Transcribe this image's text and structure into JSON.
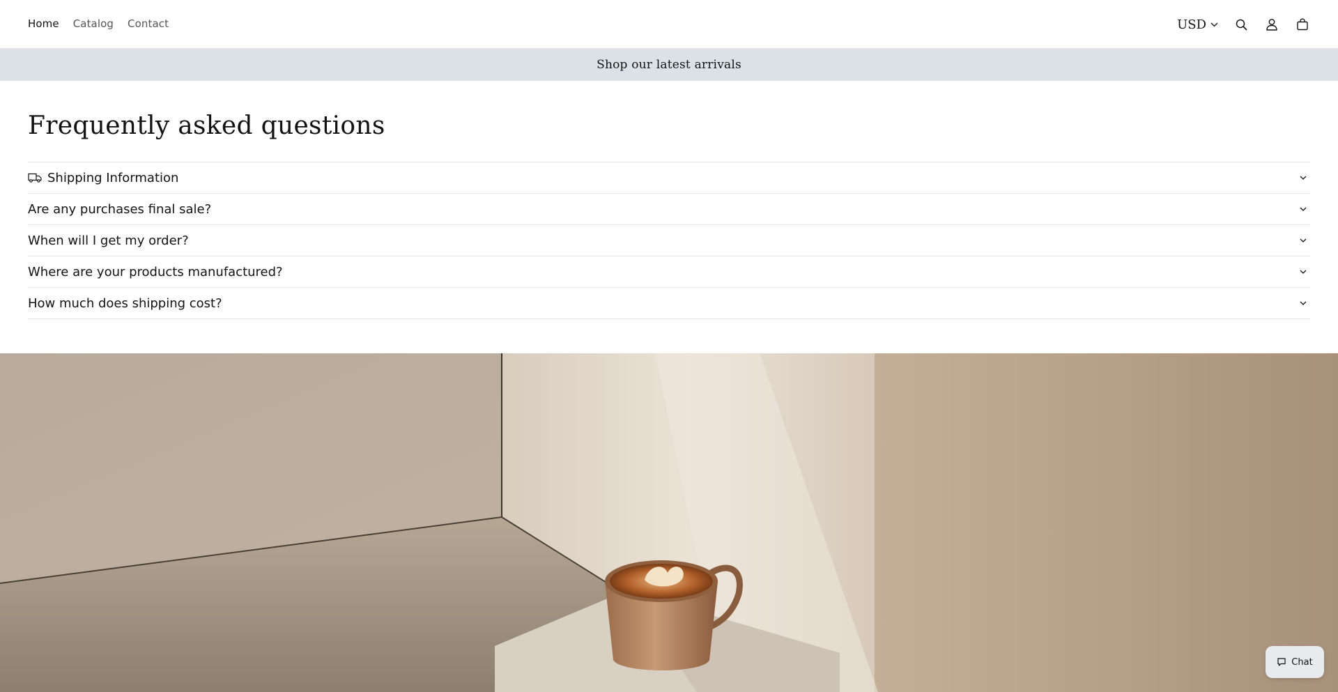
{
  "nav": {
    "items": [
      {
        "label": "Home",
        "active": true
      },
      {
        "label": "Catalog",
        "active": false
      },
      {
        "label": "Contact",
        "active": false
      }
    ]
  },
  "header": {
    "currency": "USD",
    "icons": [
      "search-icon",
      "account-icon",
      "cart-icon"
    ]
  },
  "announcement": {
    "text": "Shop our latest arrivals",
    "background": "#dae2e7"
  },
  "faq": {
    "title": "Frequently asked questions",
    "items": [
      {
        "label": "Shipping Information",
        "icon": "truck-icon"
      },
      {
        "label": "Are any purchases final sale?"
      },
      {
        "label": "When will I get my order?"
      },
      {
        "label": "Where are your products manufactured?"
      },
      {
        "label": "How much does shipping cost?"
      }
    ]
  },
  "hero": {
    "image": "latte cup on a box in a sunlit room corner"
  },
  "chat": {
    "label": "Chat"
  }
}
